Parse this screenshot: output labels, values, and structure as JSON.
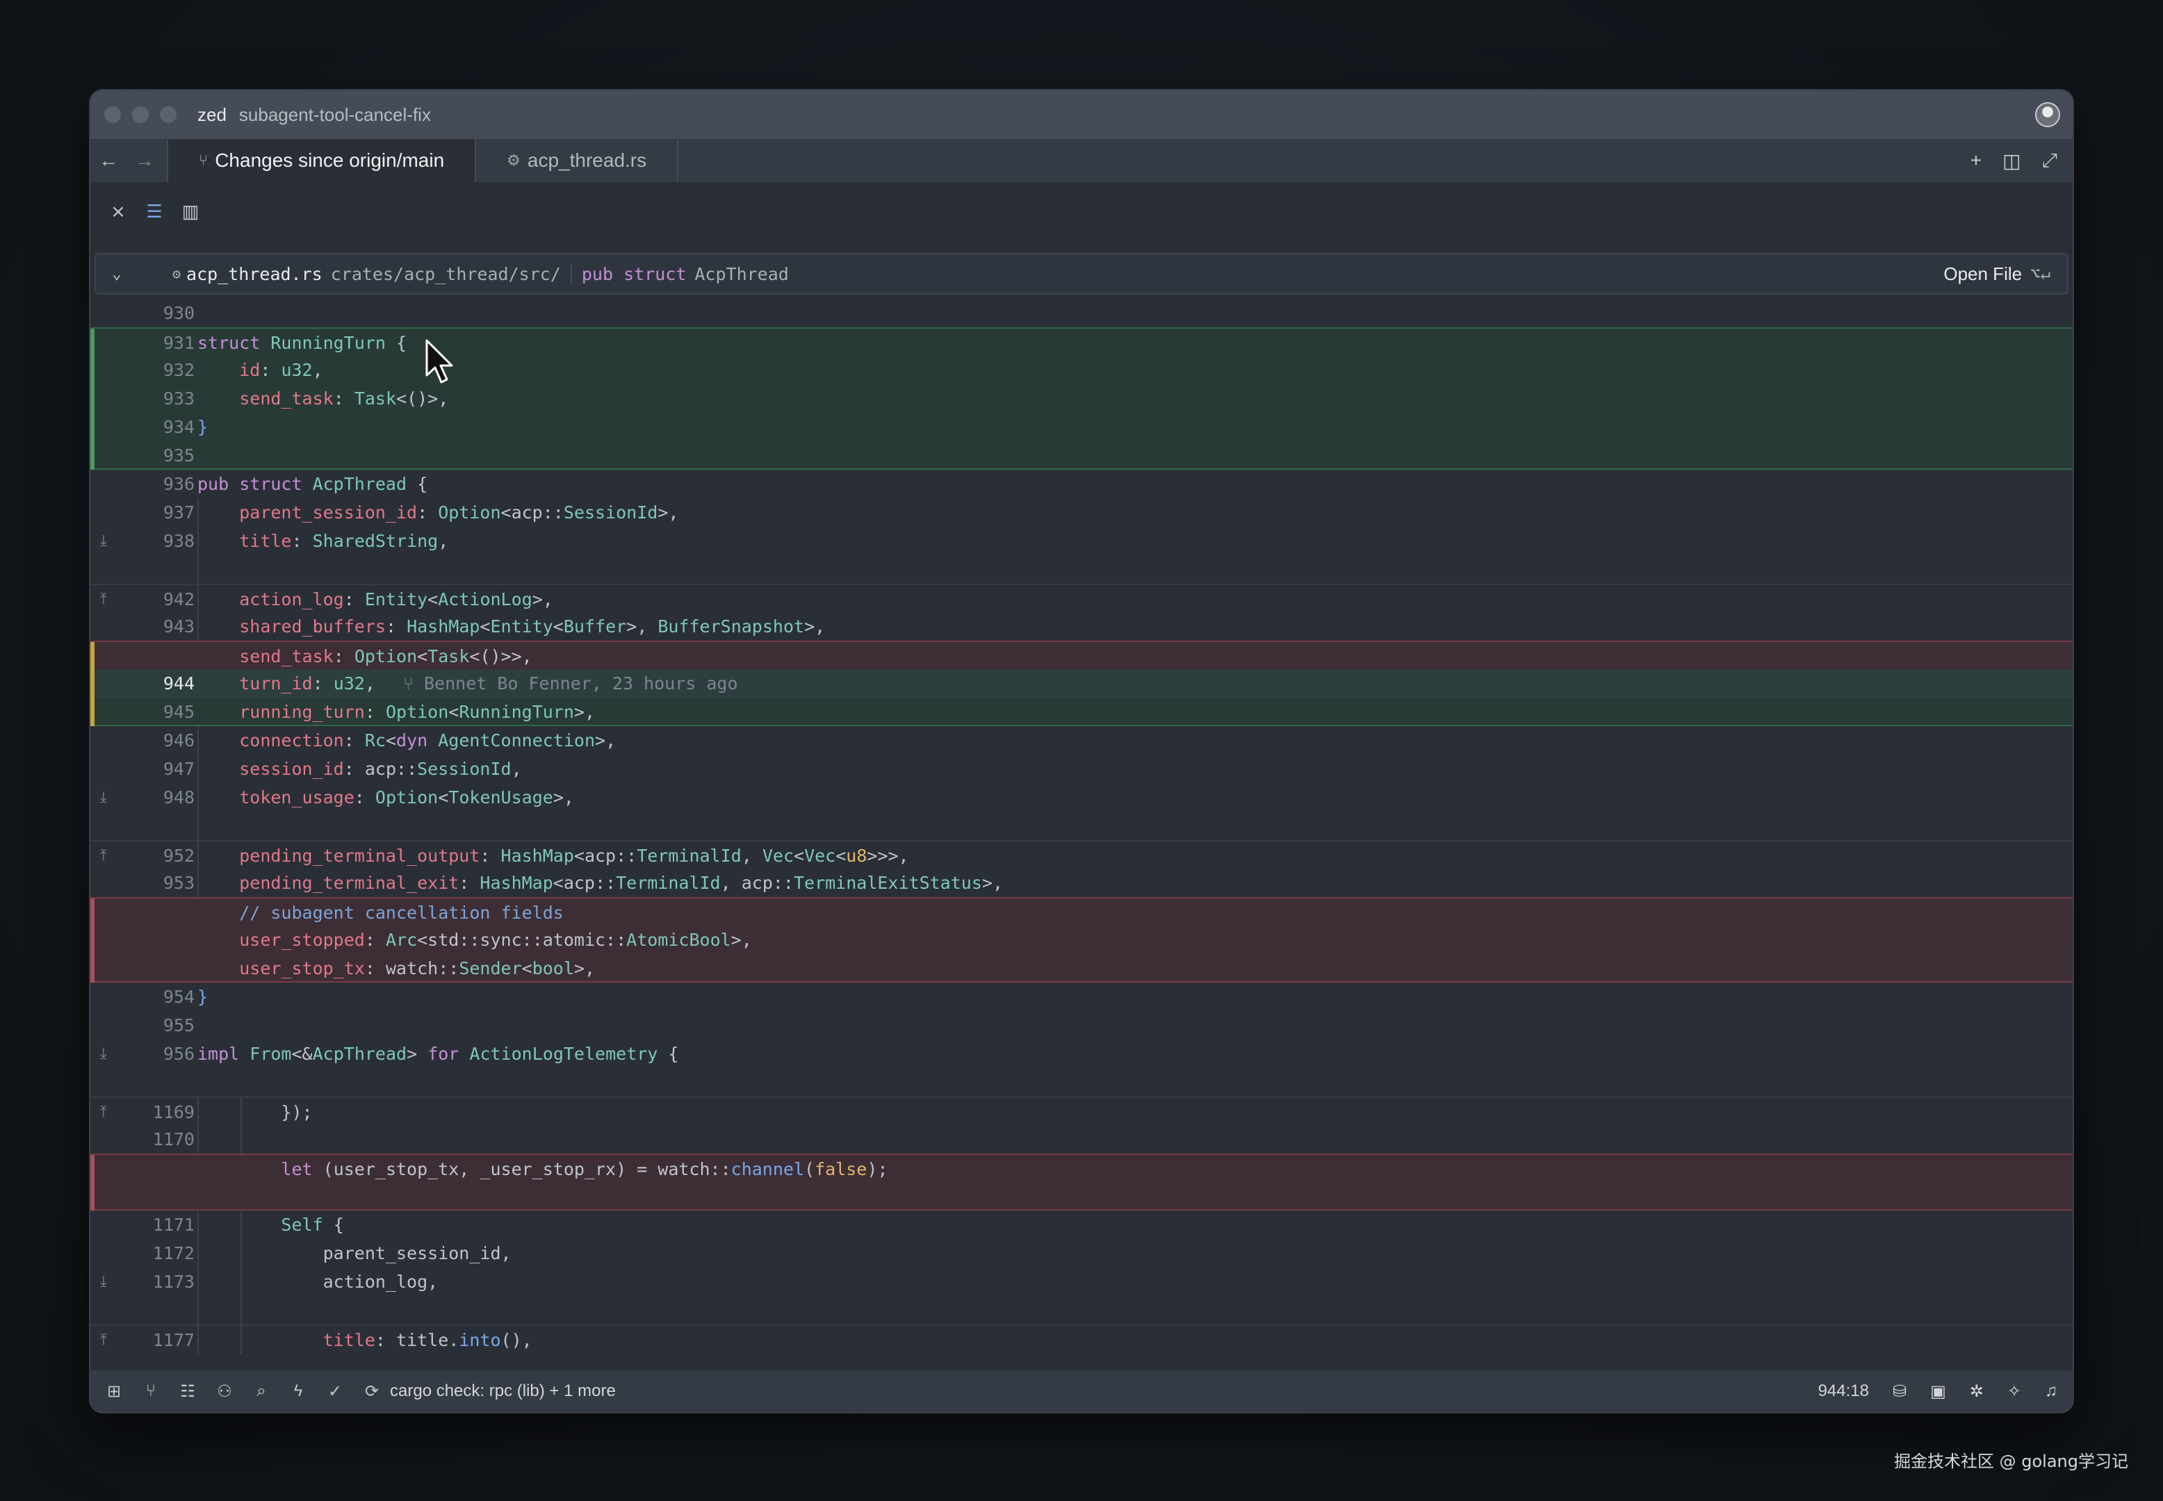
{
  "window": {
    "app_name": "zed",
    "branch": "subagent-tool-cancel-fix"
  },
  "tabs": [
    {
      "label": "Changes since origin/main",
      "icon": "git-branch-icon",
      "active": true
    },
    {
      "label": "acp_thread.rs",
      "icon": "rust-file-icon",
      "active": false
    }
  ],
  "breadcrumb": {
    "file_name": "acp_thread.rs",
    "file_path": "crates/acp_thread/src/",
    "symbol_kw": "pub struct",
    "symbol_name": "AcpThread",
    "open_file_label": "Open File",
    "shortcut": "⌥↵"
  },
  "code_lines": [
    {
      "num": "930",
      "text": ""
    },
    {
      "num": "931",
      "text": "struct RunningTurn {"
    },
    {
      "num": "932",
      "text": "    id: u32,"
    },
    {
      "num": "933",
      "text": "    send_task: Task<()>,"
    },
    {
      "num": "934",
      "text": "}"
    },
    {
      "num": "935",
      "text": ""
    },
    {
      "num": "936",
      "text": "pub struct AcpThread {"
    },
    {
      "num": "937",
      "text": "    parent_session_id: Option<acp::SessionId>,"
    },
    {
      "num": "938",
      "text": "    title: SharedString,"
    },
    {
      "num": "",
      "text": ""
    },
    {
      "num": "942",
      "text": "    action_log: Entity<ActionLog>,"
    },
    {
      "num": "943",
      "text": "    shared_buffers: HashMap<Entity<Buffer>, BufferSnapshot>,"
    },
    {
      "num": "",
      "text": "    send_task: Option<Task<()>>,"
    },
    {
      "num": "944",
      "text": "    turn_id: u32,",
      "blame": "Bennet Bo Fenner, 23 hours ago"
    },
    {
      "num": "945",
      "text": "    running_turn: Option<RunningTurn>,"
    },
    {
      "num": "946",
      "text": "    connection: Rc<dyn AgentConnection>,"
    },
    {
      "num": "947",
      "text": "    session_id: acp::SessionId,"
    },
    {
      "num": "948",
      "text": "    token_usage: Option<TokenUsage>,"
    },
    {
      "num": "",
      "text": ""
    },
    {
      "num": "952",
      "text": "    pending_terminal_output: HashMap<acp::TerminalId, Vec<Vec<u8>>>,"
    },
    {
      "num": "953",
      "text": "    pending_terminal_exit: HashMap<acp::TerminalId, acp::TerminalExitStatus>,"
    },
    {
      "num": "",
      "text": "    // subagent cancellation fields"
    },
    {
      "num": "",
      "text": "    user_stopped: Arc<std::sync::atomic::AtomicBool>,"
    },
    {
      "num": "",
      "text": "    user_stop_tx: watch::Sender<bool>,"
    },
    {
      "num": "954",
      "text": "}"
    },
    {
      "num": "955",
      "text": ""
    },
    {
      "num": "956",
      "text": "impl From<&AcpThread> for ActionLogTelemetry {"
    },
    {
      "num": "",
      "text": ""
    },
    {
      "num": "1169",
      "text": "        });"
    },
    {
      "num": "1170",
      "text": ""
    },
    {
      "num": "",
      "text": "        let (user_stop_tx, _user_stop_rx) = watch::channel(false);"
    },
    {
      "num": "",
      "text": ""
    },
    {
      "num": "1171",
      "text": "        Self {"
    },
    {
      "num": "1172",
      "text": "            parent_session_id,"
    },
    {
      "num": "1173",
      "text": "            action_log,"
    },
    {
      "num": "",
      "text": ""
    },
    {
      "num": "1177",
      "text": "            title: title.into(),"
    }
  ],
  "status_bar": {
    "message": "cargo check: rpc (lib) + 1 more",
    "cursor_position": "944:18"
  },
  "watermark": "掘金技术社区 @ golang学习记"
}
